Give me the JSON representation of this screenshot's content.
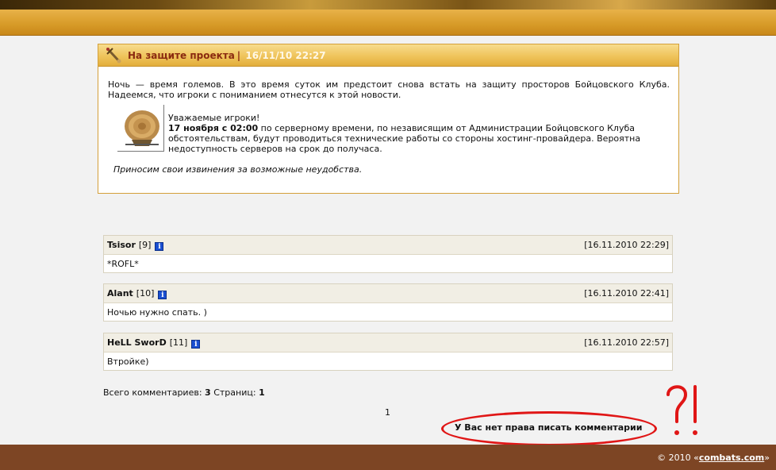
{
  "news": {
    "title": "На защите проекта",
    "separator": "|",
    "date": "16/11/10 22:27",
    "intro": "Ночь — время големов. В это время суток им предстоит снова встать на защиту просторов Бойцовского Клуба. Надеемся, что игроки с пониманием отнесутся к этой новости.",
    "greeting": "Уважаемые игроки!",
    "notice_bold": "17 ноября с 02:00",
    "notice_rest": " по серверному времени, по независящим от Администрации Бойцовского Клуба обстоятельствам, будут проводиться технические работы со стороны хостинг-провайдера. Вероятна недоступность серверов на срок до получаса.",
    "apology": "Приносим свои извинения за возможные неудобства."
  },
  "comments": [
    {
      "author": "Tsisor",
      "level": "[9]",
      "date": "[16.11.2010 22:29]",
      "text": "*ROFL*"
    },
    {
      "author": "Alant",
      "level": "[10]",
      "date": "[16.11.2010 22:41]",
      "text": "Ночью нужно спать. )"
    },
    {
      "author": "HeLL SworD",
      "level": "[11]",
      "date": "[16.11.2010 22:57]",
      "text": "Втройке)"
    }
  ],
  "totals": {
    "comments_label": "Всего комментариев:",
    "comments_count": "3",
    "pages_label": "Страниц:",
    "pages_count": "1"
  },
  "pagination": {
    "current": "1"
  },
  "no_rights": "У Вас нет права писать комментарии",
  "annotation": "?!",
  "footer": {
    "copyright": "© 2010 «",
    "link": "combats.com",
    "close": "»"
  },
  "colors": {
    "accent": "#d79a27",
    "footer": "#7d4524",
    "annotation": "#e01616",
    "title": "#8a2a10"
  }
}
